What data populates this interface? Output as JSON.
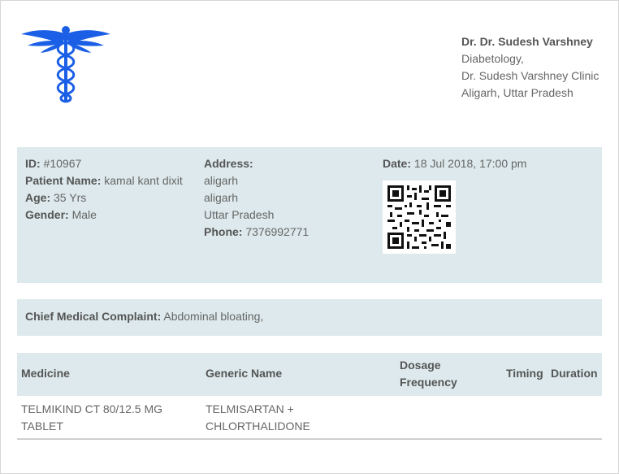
{
  "doctor": {
    "name": "Dr. Dr. Sudesh Varshney",
    "specialty": "Diabetology,",
    "clinic": "Dr. Sudesh Varshney Clinic",
    "location": "Aligarh, Uttar Pradesh"
  },
  "patient": {
    "id_label": "ID:",
    "id_value": "#10967",
    "name_label": "Patient Name:",
    "name_value": "kamal kant dixit",
    "age_label": "Age:",
    "age_value": "35 Yrs",
    "gender_label": "Gender:",
    "gender_value": "Male"
  },
  "address": {
    "label": "Address:",
    "line1": "aligarh",
    "line2": "aligarh",
    "line3": "Uttar Pradesh",
    "phone_label": "Phone:",
    "phone_value": "7376992771"
  },
  "visit": {
    "date_label": "Date:",
    "date_value": "18 Jul 2018, 17:00 pm"
  },
  "complaint": {
    "label": "Chief Medical Complaint:",
    "value": "Abdominal bloating,"
  },
  "medicines": {
    "headers": {
      "medicine": "Medicine",
      "generic": "Generic Name",
      "dosage_line1": "Dosage",
      "dosage_line2": "Frequency",
      "timing": "Timing",
      "duration": "Duration"
    },
    "rows": [
      {
        "medicine_line1": "TELMIKIND CT 80/12.5 MG",
        "medicine_line2": "TABLET",
        "generic_line1": "TELMISARTAN +",
        "generic_line2": "CHLORTHALIDONE"
      }
    ]
  },
  "icons": {
    "logo": "caduceus-icon",
    "qr": "qr-code",
    "brand_color": "#1a5fe6"
  }
}
